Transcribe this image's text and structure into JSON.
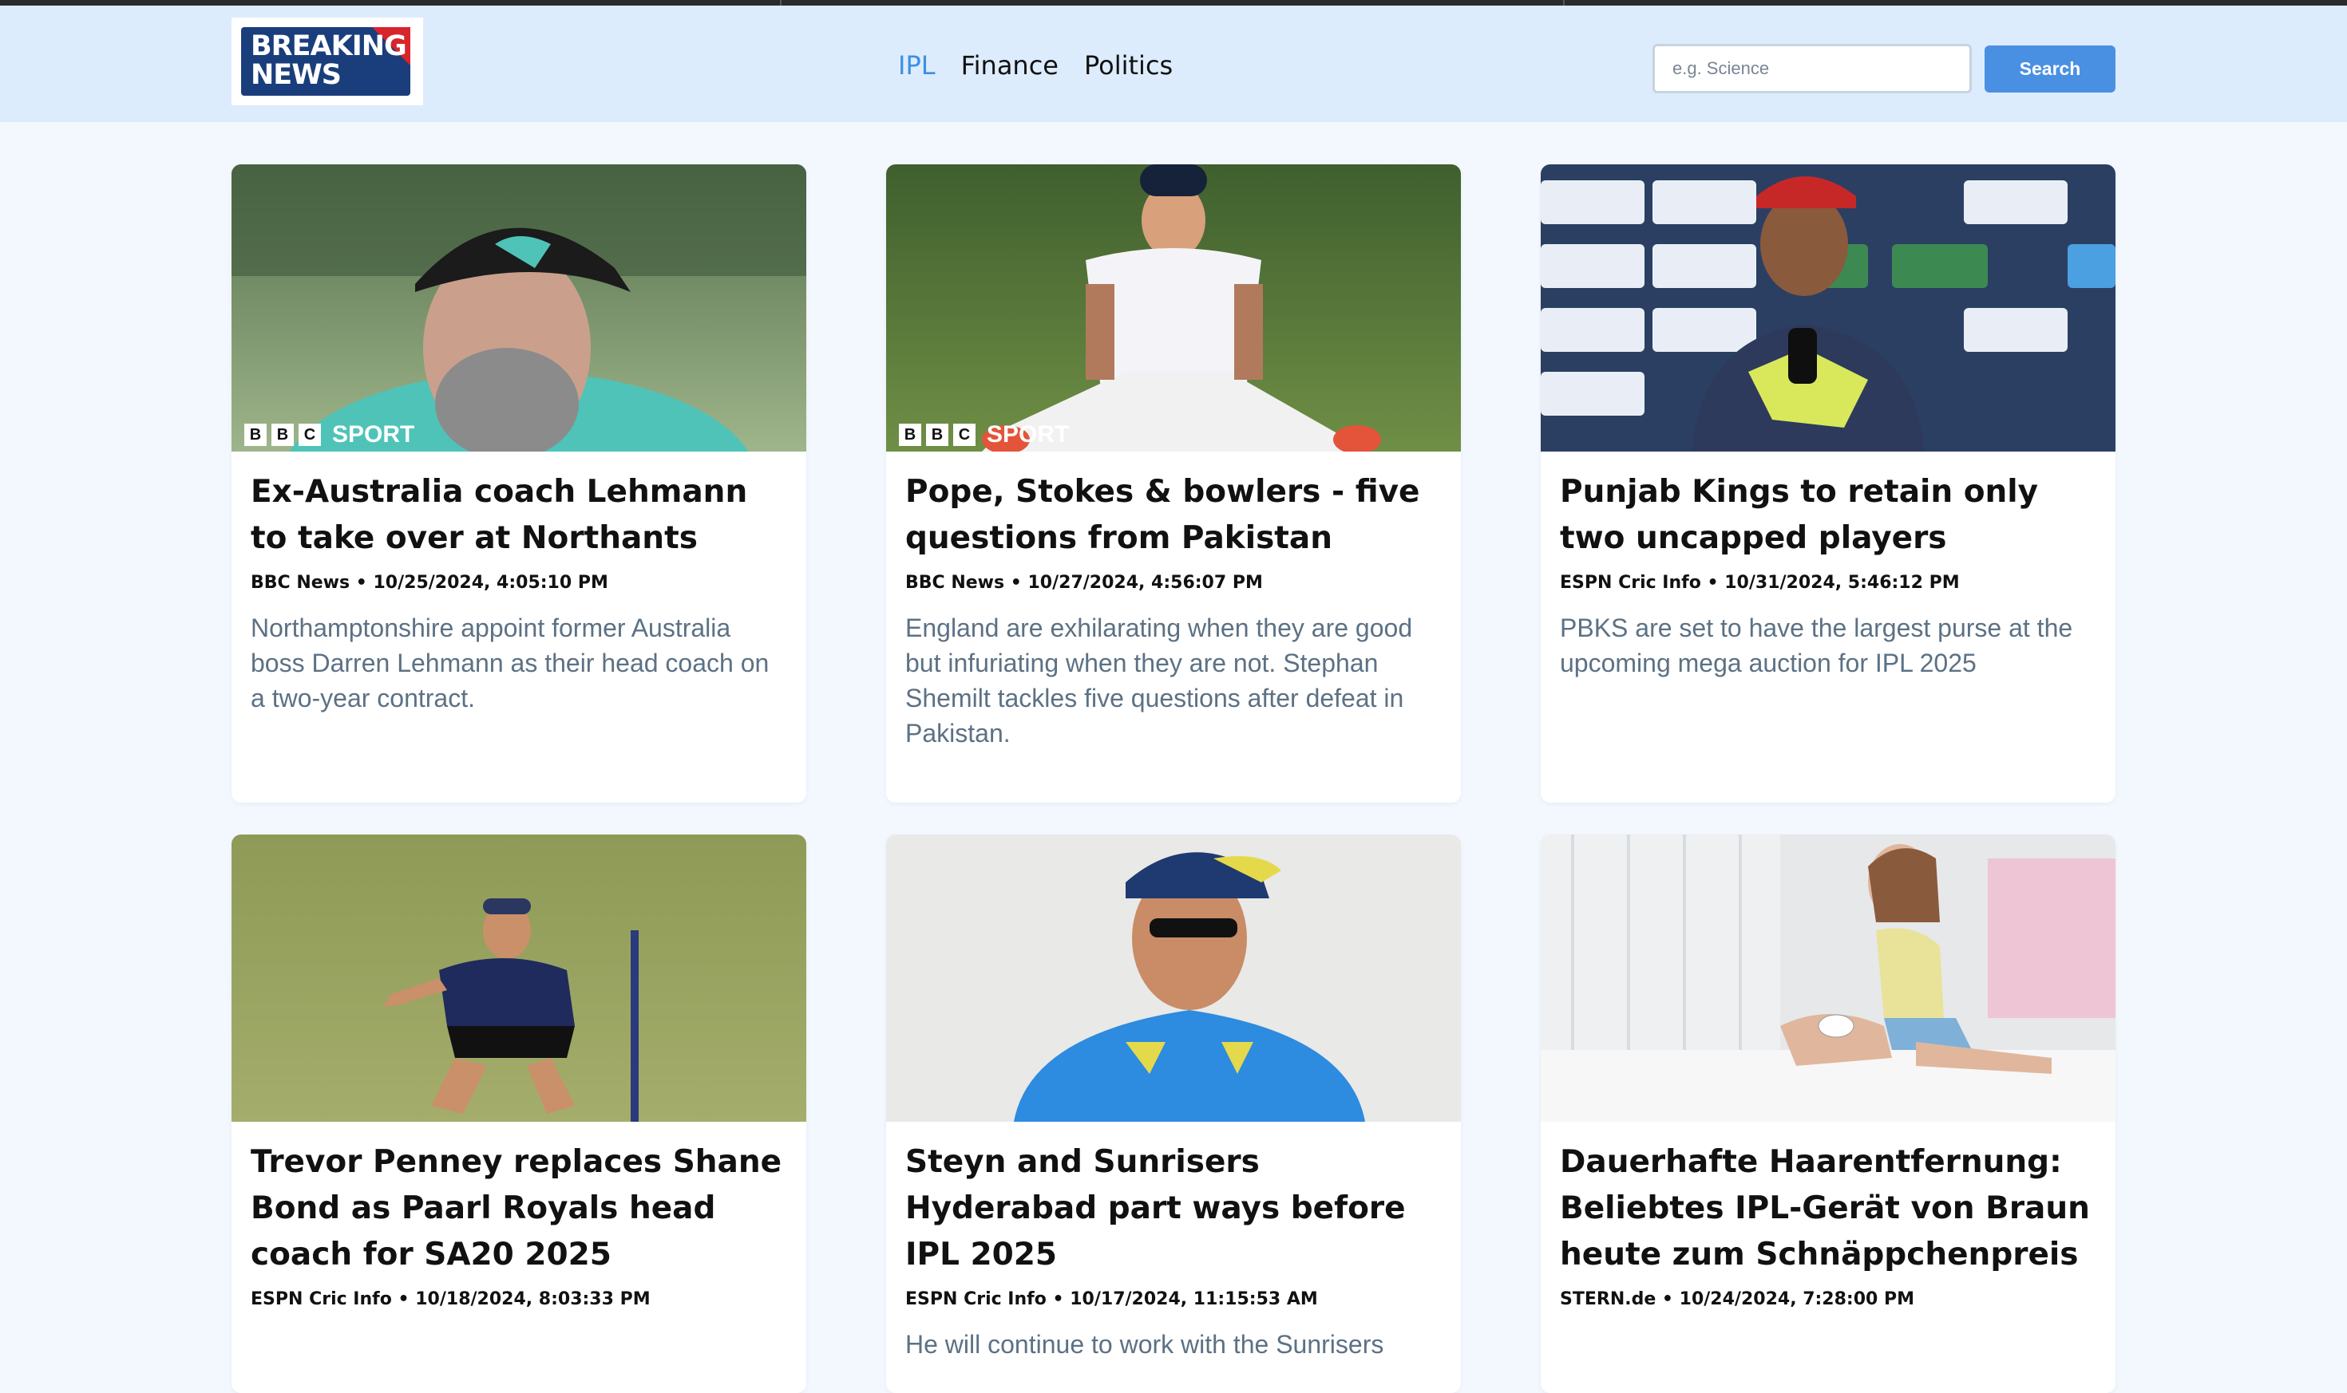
{
  "header": {
    "logo": {
      "line1": "BREAKING",
      "line2": "NEWS"
    },
    "nav": [
      {
        "label": "IPL",
        "active": true
      },
      {
        "label": "Finance",
        "active": false
      },
      {
        "label": "Politics",
        "active": false
      }
    ],
    "search": {
      "placeholder": "e.g. Science",
      "button_label": "Search"
    }
  },
  "colors": {
    "page_bg": "#f3f8fe",
    "header_bg": "#ddecfc",
    "accent": "#3d8fe4",
    "button": "#4a90e2",
    "description": "#5c7184"
  },
  "articles": [
    {
      "title": "Ex-Australia coach Lehmann to take over at Northants",
      "source": "BBC News",
      "date": "10/25/2024, 4:05:10 PM",
      "description": "Northamptonshire appoint former Australia boss Darren Lehmann as their head coach on a two-year contract.",
      "watermark": {
        "letters": [
          "B",
          "B",
          "C"
        ],
        "label": "SPORT"
      }
    },
    {
      "title": "Pope, Stokes & bowlers - five questions from Pakistan",
      "source": "BBC News",
      "date": "10/27/2024, 4:56:07 PM",
      "description": "England are exhilarating when they are good but infuriating when they are not. Stephan Shemilt tackles five questions after defeat in Pakistan.",
      "watermark": {
        "letters": [
          "B",
          "B",
          "C"
        ],
        "label": "SPORT"
      }
    },
    {
      "title": "Punjab Kings to retain only two uncapped players",
      "source": "ESPN Cric Info",
      "date": "10/31/2024, 5:46:12 PM",
      "description": "PBKS are set to have the largest purse at the upcoming mega auction for IPL 2025"
    },
    {
      "title": "Trevor Penney replaces Shane Bond as Paarl Royals head coach for SA20 2025",
      "source": "ESPN Cric Info",
      "date": "10/18/2024, 8:03:33 PM",
      "description": ""
    },
    {
      "title": "Steyn and Sunrisers Hyderabad part ways before IPL 2025",
      "source": "ESPN Cric Info",
      "date": "10/17/2024, 11:15:53 AM",
      "description": "He will continue to work with the Sunrisers"
    },
    {
      "title": "Dauerhafte Haarentfernung: Beliebtes IPL-Gerät von Braun heute zum Schnäppchenpreis",
      "source": "STERN.de",
      "date": "10/24/2024, 7:28:00 PM",
      "description": ""
    }
  ]
}
